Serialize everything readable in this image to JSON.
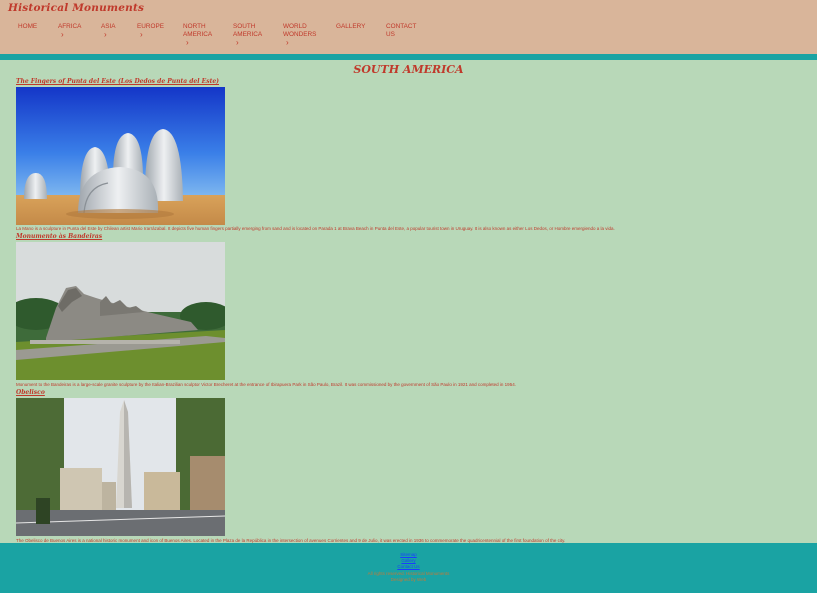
{
  "site": {
    "title": "Historical Monuments"
  },
  "nav": [
    {
      "label": "HOME",
      "has_chevron": false
    },
    {
      "label": "AFRICA",
      "has_chevron": true
    },
    {
      "label": "ASIA",
      "has_chevron": true
    },
    {
      "label": "EUROPE",
      "has_chevron": true
    },
    {
      "label": "NORTH AMERICA",
      "has_chevron": true
    },
    {
      "label": "SOUTH AMERICA",
      "has_chevron": true
    },
    {
      "label": "WORLD WONDERS",
      "has_chevron": true
    },
    {
      "label": "GALLERY",
      "has_chevron": false
    },
    {
      "label": "CONTACT US",
      "has_chevron": false
    }
  ],
  "nav_chevron": "›",
  "page": {
    "heading": "SOUTH AMERICA"
  },
  "monuments": [
    {
      "title": "The Fingers of Punta del Este (Los Dedos de Punta del Este)",
      "caption": "La Mano is a sculpture in Punta del Este by Chilean artist Mario Irarrázabal. It depicts five human fingers partially emerging from sand and is located on Parada 1 at Brava Beach in Punta del Este, a popular tourist town in Uruguay. It is also known as either Los Dedos, or Hombre emergiendo a la vida."
    },
    {
      "title": "Monumento às Bandeiras",
      "caption": "Monument to the Bandeiras is a large-scale granite sculpture by the Italian-Brazilian sculptor Victor Brecheret at the entrance of Ibirapuera Park in São Paulo, Brazil. It was commissioned by the government of São Paulo in 1921 and completed in 1954."
    },
    {
      "title": "Obelisco",
      "caption": "The Obelisco de Buenos Aires is a national historic monument and icon of Buenos Aires. Located in the Plaza de la República in the intersection of avenues Corrientes and 9 de Julio, it was erected in 1936 to commemorate the quadricentennial of the first foundation of the city."
    }
  ],
  "footer": {
    "links": [
      "Sitemap",
      "Gallery",
      "Contact Us"
    ],
    "lines": [
      "All rights reserved. Historical Monuments",
      "Designed by Web"
    ]
  },
  "colors": {
    "header_bg": "#d9b59a",
    "page_bg": "#b8d8b8",
    "accent_teal": "#1aa3a3",
    "title_red": "#c0392b"
  }
}
